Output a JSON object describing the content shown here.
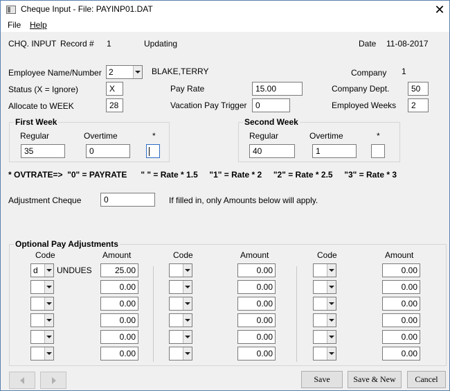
{
  "window": {
    "title": "Cheque Input - File: PAYINP01.DAT"
  },
  "menu": {
    "items": [
      "File",
      "Help"
    ]
  },
  "header": {
    "form": "CHQ. INPUT",
    "record_label": "Record #",
    "record_value": "1",
    "mode": "Updating",
    "date_label": "Date",
    "date_value": "11-08-2017"
  },
  "employee": {
    "name_label": "Employee Name/Number",
    "number": "2",
    "name": "BLAKE,TERRY",
    "company_label": "Company",
    "company_value": "1",
    "status_label": "Status (X = Ignore)",
    "status_value": "X",
    "pay_rate_label": "Pay Rate",
    "pay_rate_value": "15.00",
    "dept_label": "Company Dept.",
    "dept_value": "50",
    "week_label": "Allocate to WEEK",
    "week_value": "28",
    "vacation_label": "Vacation Pay Trigger",
    "vacation_value": "0",
    "employed_label": "Employed Weeks",
    "employed_value": "2"
  },
  "first_week": {
    "title": "First Week",
    "regular_label": "Regular",
    "overtime_label": "Overtime",
    "star_label": "*",
    "regular": "35",
    "overtime": "0",
    "star": ""
  },
  "second_week": {
    "title": "Second Week",
    "regular_label": "Regular",
    "overtime_label": "Overtime",
    "star_label": "*",
    "regular": "40",
    "overtime": "1",
    "star": ""
  },
  "ovtrate_note": "* OVTRATE=>  \"0\" = PAYRATE      \" \" = Rate * 1.5     \"1\" = Rate * 2     \"2\" = Rate * 2.5     \"3\" = Rate * 3",
  "adjustment": {
    "label": "Adjustment Cheque",
    "value": "0",
    "note": "If filled in, only Amounts below will apply."
  },
  "optional": {
    "title": "Optional Pay Adjustments",
    "code_header": "Code",
    "amount_header": "Amount",
    "columns": [
      {
        "rows": [
          {
            "code": "d",
            "desc": "UNDUES",
            "amount": "25.00"
          },
          {
            "code": "",
            "desc": "",
            "amount": "0.00"
          },
          {
            "code": "",
            "desc": "",
            "amount": "0.00"
          },
          {
            "code": "",
            "desc": "",
            "amount": "0.00"
          },
          {
            "code": "",
            "desc": "",
            "amount": "0.00"
          },
          {
            "code": "",
            "desc": "",
            "amount": "0.00"
          }
        ]
      },
      {
        "rows": [
          {
            "code": "",
            "desc": "",
            "amount": "0.00"
          },
          {
            "code": "",
            "desc": "",
            "amount": "0.00"
          },
          {
            "code": "",
            "desc": "",
            "amount": "0.00"
          },
          {
            "code": "",
            "desc": "",
            "amount": "0.00"
          },
          {
            "code": "",
            "desc": "",
            "amount": "0.00"
          },
          {
            "code": "",
            "desc": "",
            "amount": "0.00"
          }
        ]
      },
      {
        "rows": [
          {
            "code": "",
            "desc": "",
            "amount": "0.00"
          },
          {
            "code": "",
            "desc": "",
            "amount": "0.00"
          },
          {
            "code": "",
            "desc": "",
            "amount": "0.00"
          },
          {
            "code": "",
            "desc": "",
            "amount": "0.00"
          },
          {
            "code": "",
            "desc": "",
            "amount": "0.00"
          },
          {
            "code": "",
            "desc": "",
            "amount": "0.00"
          }
        ]
      }
    ]
  },
  "buttons": {
    "save": "Save",
    "save_new": "Save & New",
    "cancel": "Cancel"
  },
  "icons": {
    "app": "window-app-icon",
    "close": "close-icon",
    "prev": "prev-arrow-icon",
    "next": "next-arrow-icon",
    "dropdown": "chevron-down-icon"
  }
}
